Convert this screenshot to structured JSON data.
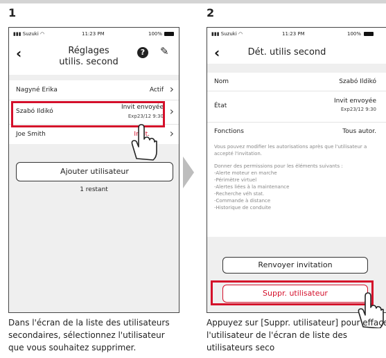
{
  "steps": {
    "step1": {
      "number": "1",
      "status": {
        "carrier": "Suzuki",
        "time": "11:23 PM",
        "battery": "100%"
      },
      "title_line1": "Réglages",
      "title_line2": "utilis. second",
      "users": [
        {
          "name": "Nagyné Erika",
          "status": "Actif",
          "expiry": ""
        },
        {
          "name": "Szabó Ildikó",
          "status": "Invit envoyée",
          "expiry": "Exp23/12 9:30"
        },
        {
          "name": "Joe Smith",
          "status": "Invit.",
          "expiry": ""
        }
      ],
      "add_button": "Ajouter utilisateur",
      "remaining": "1 restant",
      "caption": "Dans l'écran de la liste des utilisateurs secondaires, sélectionnez l'utilisateur que vous souhaitez supprimer."
    },
    "step2": {
      "number": "2",
      "status": {
        "carrier": "Suzuki",
        "time": "11:23 PM",
        "battery": "100%"
      },
      "title": "Dét. utilis second",
      "fields": {
        "name_label": "Nom",
        "name_value": "Szabó Ildikó",
        "state_label": "État",
        "state_value": "Invit envoyée",
        "state_expiry": "Exp23/12 9:30",
        "functions_label": "Fonctions",
        "functions_value": "Tous autor."
      },
      "info1": "Vous pouvez modifier les autorisations après que l'utilisateur a accepté l'invitation.",
      "info2": "Donner des permissions pour les éléments suivants :",
      "permissions": [
        "-Alerte moteur en marche",
        "-Périmètre virtuel",
        "-Alertes liées à la maintenance",
        "-Recherche véh stat.",
        "-Commande à distance",
        "-Historique de conduite"
      ],
      "resend_button": "Renvoyer invitation",
      "delete_button": "Suppr. utilisateur",
      "caption": "Appuyez sur [Suppr. utilisateur] pour effacer l'utilisateur de l'écran de liste des utilisateurs seco"
    }
  },
  "colors": {
    "highlight": "#d40f2a",
    "gray_bg": "#efefef",
    "delete_text": "#d40f2a"
  }
}
